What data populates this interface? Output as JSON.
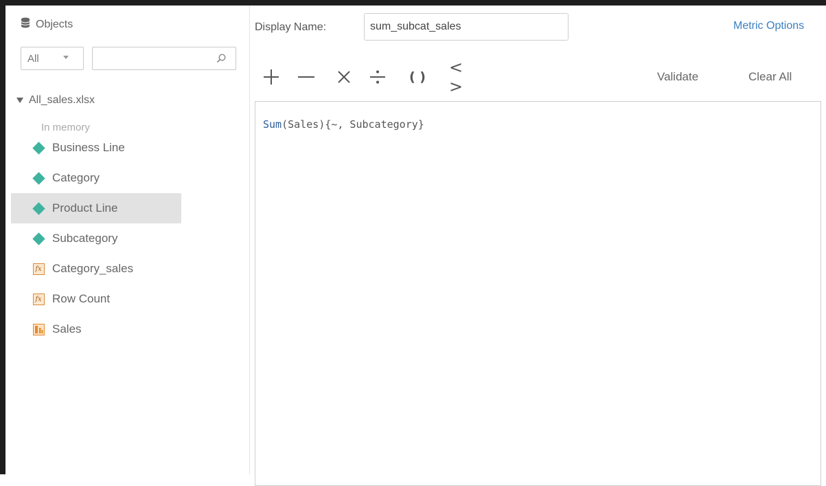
{
  "objects_panel": {
    "title": "Objects",
    "filter_value": "All",
    "search_value": "",
    "tree": {
      "root_label": "All_sales.xlsx",
      "status": "In memory",
      "items": [
        {
          "label": "Business Line",
          "icon": "attribute-diamond-icon",
          "selected": false
        },
        {
          "label": "Category",
          "icon": "attribute-diamond-icon",
          "selected": false
        },
        {
          "label": "Product Line",
          "icon": "attribute-diamond-icon",
          "selected": true
        },
        {
          "label": "Subcategory",
          "icon": "attribute-diamond-icon",
          "selected": false
        },
        {
          "label": "Category_sales",
          "icon": "derived-metric-fx-icon",
          "selected": false
        },
        {
          "label": "Row Count",
          "icon": "derived-metric-fx-icon",
          "selected": false
        },
        {
          "label": "Sales",
          "icon": "metric-icon",
          "selected": false
        }
      ]
    }
  },
  "metric_editor": {
    "display_name_label": "Display Name:",
    "display_name_value": "sum_subcat_sales",
    "metric_options_label": "Metric Options",
    "toolbar": {
      "operators": [
        "+",
        "−",
        "×",
        "÷",
        "( )",
        "< >"
      ],
      "validate_label": "Validate",
      "clear_all_label": "Clear All"
    },
    "formula": {
      "function": "Sum",
      "rest": "(Sales){~, Subcategory}"
    }
  },
  "colors": {
    "attribute": "#3fb39f",
    "metric": "#e58a2c",
    "link": "#3c7fc0",
    "selection": "#e2e2e2"
  }
}
